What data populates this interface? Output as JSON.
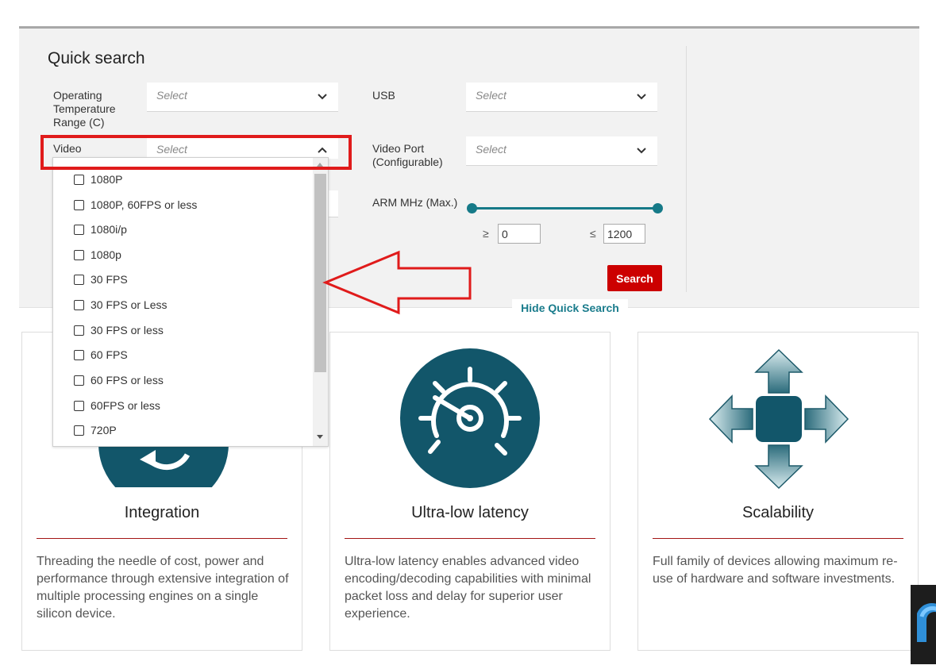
{
  "quick_search": {
    "title": "Quick search",
    "fields": {
      "operating_temperature": {
        "label": "Operating Temperature Range (C)",
        "value": "Select"
      },
      "usb": {
        "label": "USB",
        "value": "Select"
      },
      "video": {
        "label": "Video",
        "value": "Select"
      },
      "video_port": {
        "label": "Video Port (Configurable)",
        "value": "Select"
      },
      "arm_mhz": {
        "label": "ARM MHz (Max.)",
        "min_symbol": "≥",
        "max_symbol": "≤",
        "min_value": "0",
        "max_value": "1200"
      }
    },
    "search_button": "Search",
    "hide_link": "Hide Quick Search"
  },
  "video_dropdown": {
    "options": [
      "1080P",
      "1080P, 60FPS or less",
      "1080i/p",
      "1080p",
      "30 FPS",
      "30 FPS or Less",
      "30 FPS or less",
      "60 FPS",
      "60 FPS or less",
      "60FPS or less",
      "720P"
    ]
  },
  "features": [
    {
      "title": "Integration",
      "description": "Threading the needle of cost, power and performance through extensive integration of multiple processing engines on a single silicon device."
    },
    {
      "title": "Ultra-low latency",
      "description": "Ultra-low latency enables advanced video encoding/decoding capabilities with minimal packet loss and delay for superior user experience."
    },
    {
      "title": "Scalability",
      "description": "Full family of devices allowing maximum re-use of hardware and software investments."
    }
  ],
  "colors": {
    "accent": "#167a88",
    "primary_red": "#cc0000",
    "annotation_red": "#e01b1b",
    "icon_teal": "#12566a"
  }
}
